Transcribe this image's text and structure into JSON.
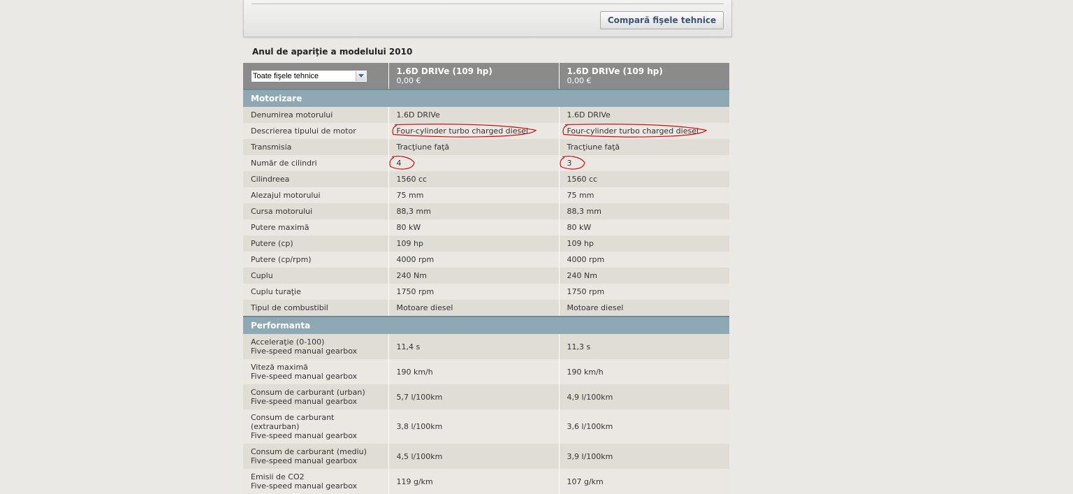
{
  "compare_button": "Compară fişele tehnice",
  "model_year": "Anul de apariţie a modelului 2010",
  "select_value": "Toate fişele tehnice",
  "columns": [
    {
      "model": "1.6D DRIVe (109 hp)",
      "price": "0,00 €"
    },
    {
      "model": "1.6D DRIVe (109 hp)",
      "price": "0,00 €"
    }
  ],
  "sections": [
    {
      "title": "Motorizare",
      "rows": [
        {
          "label": [
            "Denumirea motorului"
          ],
          "values": [
            "1.6D DRIVe",
            "1.6D DRIVe"
          ]
        },
        {
          "label": [
            "Descrierea tipului de motor"
          ],
          "values": [
            "Four-cylinder turbo charged diesel",
            "Four-cylinder turbo charged diesel"
          ]
        },
        {
          "label": [
            "Transmisia"
          ],
          "values": [
            "Tracţiune faţă",
            "Tracţiune faţă"
          ]
        },
        {
          "label": [
            "Număr de cilindri"
          ],
          "values": [
            "4",
            "3"
          ]
        },
        {
          "label": [
            "Cilindreea"
          ],
          "values": [
            "1560 cc",
            "1560 cc"
          ]
        },
        {
          "label": [
            "Alezajul motorului"
          ],
          "values": [
            "75 mm",
            "75 mm"
          ]
        },
        {
          "label": [
            "Cursa motorului"
          ],
          "values": [
            "88,3 mm",
            "88,3 mm"
          ]
        },
        {
          "label": [
            "Putere maximă"
          ],
          "values": [
            "80 kW",
            "80 kW"
          ]
        },
        {
          "label": [
            "Putere (cp)"
          ],
          "values": [
            "109 hp",
            "109 hp"
          ]
        },
        {
          "label": [
            "Putere (cp/rpm)"
          ],
          "values": [
            "4000 rpm",
            "4000 rpm"
          ]
        },
        {
          "label": [
            "Cuplu"
          ],
          "values": [
            "240 Nm",
            "240 Nm"
          ]
        },
        {
          "label": [
            "Cuplu turaţie"
          ],
          "values": [
            "1750 rpm",
            "1750 rpm"
          ]
        },
        {
          "label": [
            "Tipul de combustibil"
          ],
          "values": [
            "Motoare diesel",
            "Motoare diesel"
          ]
        }
      ]
    },
    {
      "title": "Performanta",
      "rows": [
        {
          "label": [
            "Acceleraţie (0-100)",
            "Five-speed manual gearbox"
          ],
          "values": [
            "11,4 s",
            "11,3 s"
          ]
        },
        {
          "label": [
            "Viteză maximă",
            "Five-speed manual gearbox"
          ],
          "values": [
            "190 km/h",
            "190 km/h"
          ]
        },
        {
          "label": [
            "Consum de carburant (urban)",
            "Five-speed manual gearbox"
          ],
          "values": [
            "5,7 l/100km",
            "4,9 l/100km"
          ]
        },
        {
          "label": [
            "Consum de carburant",
            "(extraurban)",
            "Five-speed manual gearbox"
          ],
          "values": [
            "3,8 l/100km",
            "3,6 l/100km"
          ]
        },
        {
          "label": [
            "Consum de carburant (mediu)",
            "Five-speed manual gearbox"
          ],
          "values": [
            "4,5 l/100km",
            "3,9 l/100km"
          ]
        },
        {
          "label": [
            "Emisii de CO2",
            "Five-speed manual gearbox"
          ],
          "values": [
            "119 g/km",
            "107 g/km"
          ]
        }
      ]
    }
  ],
  "annotation_color": "#d01010"
}
